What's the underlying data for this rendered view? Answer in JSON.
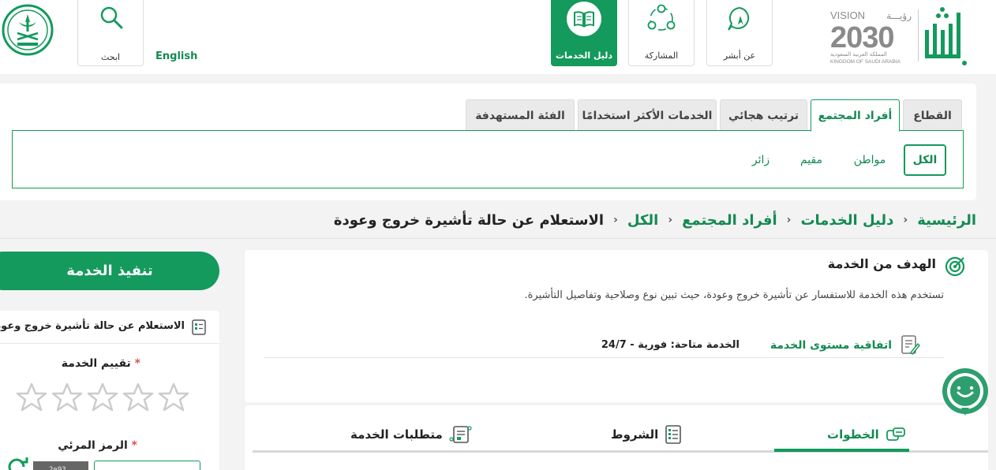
{
  "header": {
    "english_label": "English",
    "search_label": "ابحث",
    "tiles": [
      {
        "label": "دليل الخدمات",
        "icon": "book-icon",
        "active": true
      },
      {
        "label": "المشاركة",
        "icon": "people-icon",
        "active": false
      },
      {
        "label": "عن أبشر",
        "icon": "chat-pin-icon",
        "active": false
      }
    ],
    "vision_text": "VISION",
    "vision_arabic": "رؤيـــة",
    "vision_year": "2030",
    "kingdom_ar": "المملكة العربية السعودية",
    "kingdom_en": "KINGDOM OF SAUDI ARABIA"
  },
  "filters": {
    "tabs": [
      {
        "label": "القطاع",
        "active": false
      },
      {
        "label": "أفراد المجتمع",
        "active": true
      },
      {
        "label": "ترتيب هجائي",
        "active": false
      },
      {
        "label": "الخدمات الأكثر استخدامًا",
        "active": false
      },
      {
        "label": "الفئة المستهدفة",
        "active": false
      }
    ],
    "chips": [
      {
        "label": "الكل",
        "active": true
      },
      {
        "label": "مواطن",
        "active": false
      },
      {
        "label": "مقيم",
        "active": false
      },
      {
        "label": "زائر",
        "active": false
      }
    ]
  },
  "breadcrumb": {
    "items": [
      "الرئيسية",
      "دليل الخدمات",
      "أفراد المجتمع",
      "الكل"
    ],
    "current": "الاستعلام عن حالة تأشيرة خروج وعودة",
    "separator": "›"
  },
  "service": {
    "goal_title": "الهدف من الخدمة",
    "goal_desc": "تستخدم هذه الخدمة للاستفسار عن تأشيرة خروج وعودة، حيث تبين نوع وصلاحية وتفاصيل التأشيرة.",
    "sla_link": "اتفاقية مستوى الخدمة",
    "sla_value": "الخدمة متاحة: فورية - 24/7"
  },
  "detail_tabs": [
    {
      "label": "الخطوات",
      "active": true
    },
    {
      "label": "الشروط",
      "active": false
    },
    {
      "label": "متطلبات الخدمة",
      "active": false
    }
  ],
  "sidebar": {
    "execute_label": "تنفيذ الخدمة",
    "service_title": "الاستعلام عن حالة تأشيرة خروج وعودة",
    "rating_label": "تقييم الخدمة",
    "captcha_label": "الرمز المرئي",
    "required_mark": "*",
    "captcha_text": "2e93"
  },
  "colors": {
    "primary": "#139a5c",
    "primary_text": "#138a52",
    "required": "#d9534f"
  }
}
